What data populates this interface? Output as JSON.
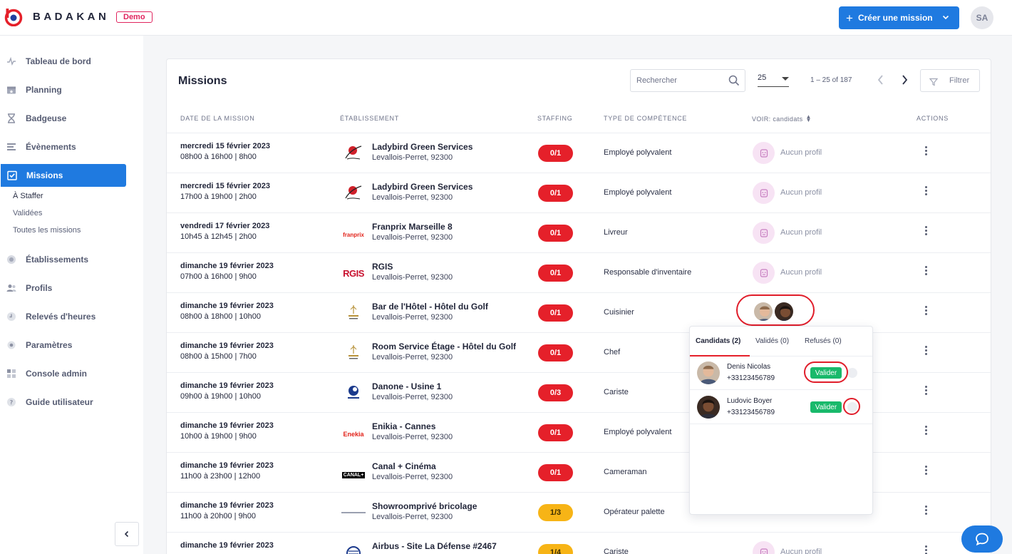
{
  "header": {
    "brand": "BADAKAN",
    "demo_badge": "Demo",
    "create_button_label": "Créer une mission",
    "user_initials": "SA",
    "accent_color": "#1f7ae0"
  },
  "sidebar": {
    "items": [
      {
        "label": "Tableau de bord",
        "icon": "pulse-icon"
      },
      {
        "label": "Planning",
        "icon": "calendar-icon"
      },
      {
        "label": "Badgeuse",
        "icon": "hourglass-icon"
      },
      {
        "label": "Évènements",
        "icon": "list-icon"
      },
      {
        "label": "Missions",
        "icon": "clipboard-check-icon",
        "active": true
      },
      {
        "label": "Établissements",
        "icon": "building-icon"
      },
      {
        "label": "Profils",
        "icon": "users-icon"
      },
      {
        "label": "Relevés d'heures",
        "icon": "clock-icon"
      },
      {
        "label": "Paramètres",
        "icon": "gear-icon"
      },
      {
        "label": "Console admin",
        "icon": "grid-icon"
      },
      {
        "label": "Guide utilisateur",
        "icon": "help-icon"
      }
    ],
    "sub_items": [
      "À Staffer",
      "Validées",
      "Toutes les missions"
    ]
  },
  "missions": {
    "title": "Missions",
    "search_placeholder": "Rechercher",
    "per_page": "25",
    "range": "1 – 25 of 187",
    "filter_label": "Filtrer",
    "columns": {
      "date": "Date de la mission",
      "establishment": "Établissement",
      "staffing": "Staffing",
      "skill": "Type de compétence",
      "candidates": "VOIR: candidats",
      "actions": "Actions"
    },
    "rows": [
      {
        "date": "mercredi 15 février 2023",
        "time": "08h00 à 16h00 | 8h00",
        "name": "Ladybird Green Services",
        "address": "Levallois-Perret, 92300",
        "staffing": "0/1",
        "skill": "Employé polyvalent",
        "candidates": "Aucun profil",
        "logo": "ladybird"
      },
      {
        "date": "mercredi 15 février 2023",
        "time": "17h00 à 19h00 | 2h00",
        "name": "Ladybird Green Services",
        "address": "Levallois-Perret, 92300",
        "staffing": "0/1",
        "skill": "Employé polyvalent",
        "candidates": "Aucun profil",
        "logo": "ladybird"
      },
      {
        "date": "vendredi 17 février 2023",
        "time": "10h45 à 12h45 | 2h00",
        "name": "Franprix Marseille 8",
        "address": "Levallois-Perret, 92300",
        "staffing": "0/1",
        "skill": "Livreur",
        "candidates": "Aucun profil",
        "logo": "franprix",
        "logo_text": "franprix"
      },
      {
        "date": "dimanche 19 février 2023",
        "time": "07h00 à 16h00 | 9h00",
        "name": "RGIS",
        "address": "Levallois-Perret, 92300",
        "staffing": "0/1",
        "skill": "Responsable d'inventaire",
        "candidates": "Aucun profil",
        "logo": "rgis",
        "logo_text": "RGIS"
      },
      {
        "date": "dimanche 19 février 2023",
        "time": "08h00 à 18h00 | 10h00",
        "name": "Bar de l'Hôtel - Hôtel du Golf",
        "address": "Levallois-Perret, 92300",
        "staffing": "0/1",
        "skill": "Cuisinier",
        "candidates": "",
        "logo": "golf"
      },
      {
        "date": "dimanche 19 février 2023",
        "time": "08h00 à 15h00 | 7h00",
        "name": "Room Service Étage - Hôtel du Golf",
        "address": "Levallois-Perret, 92300",
        "staffing": "0/1",
        "skill": "Chef",
        "candidates": "",
        "logo": "golf"
      },
      {
        "date": "dimanche 19 février 2023",
        "time": "09h00 à 19h00 | 10h00",
        "name": "Danone - Usine 1",
        "address": "Levallois-Perret, 92300",
        "staffing": "0/3",
        "skill": "Cariste",
        "candidates": "",
        "logo": "danone"
      },
      {
        "date": "dimanche 19 février 2023",
        "time": "10h00 à 19h00 | 9h00",
        "name": "Enikia - Cannes",
        "address": "Levallois-Perret, 92300",
        "staffing": "0/1",
        "skill": "Employé polyvalent",
        "candidates": "",
        "logo": "enekia",
        "logo_text": "Enekia"
      },
      {
        "date": "dimanche 19 février 2023",
        "time": "11h00 à 23h00 | 12h00",
        "name": "Canal + Cinéma",
        "address": "Levallois-Perret, 92300",
        "staffing": "0/1",
        "skill": "Cameraman",
        "candidates": "",
        "logo": "canal",
        "logo_text": "CANAL+"
      },
      {
        "date": "dimanche 19 février 2023",
        "time": "11h00 à 20h00 | 9h00",
        "name": "Showroomprivé bricolage",
        "address": "Levallois-Perret, 92300",
        "staffing": "1/3",
        "skill": "Opérateur palette",
        "candidates": "",
        "logo": "showroom"
      },
      {
        "date": "dimanche 19 février 2023",
        "time": "",
        "name": "Airbus - Site La Défense #2467",
        "address": "",
        "staffing": "1/4",
        "skill": "Cariste",
        "candidates": "Aucun profil",
        "logo": "airbus"
      }
    ]
  },
  "popup": {
    "tabs": [
      "Candidats (2)",
      "Validés (0)",
      "Refusés (0)"
    ],
    "candidates": [
      {
        "name": "Denis Nicolas",
        "phone": "+33123456789",
        "action": "Valider"
      },
      {
        "name": "Ludovic Boyer",
        "phone": "+33123456789",
        "action": "Valider"
      }
    ]
  }
}
